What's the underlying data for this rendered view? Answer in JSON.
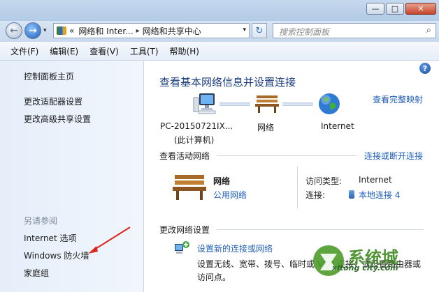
{
  "window": {
    "minimize_glyph": "—",
    "maximize_glyph": "□",
    "close_glyph": "✕"
  },
  "address": {
    "prefix": "«",
    "crumb1": "网络和 Inter...",
    "separator": "▸",
    "crumb2": "网络和共享中心",
    "dropdown_glyph": "▾"
  },
  "search": {
    "placeholder": "搜索控制面板"
  },
  "menu": [
    "文件(F)",
    "编辑(E)",
    "查看(V)",
    "工具(T)",
    "帮助(H)"
  ],
  "left_pane": {
    "home": "控制面板主页",
    "adapter": "更改适配器设置",
    "sharing": "更改高级共享设置",
    "see_also": "另请参阅",
    "internet_options": "Internet 选项",
    "firewall": "Windows 防火墙",
    "homegroup": "家庭组"
  },
  "main": {
    "help": "?",
    "title": "查看基本网络信息并设置连接",
    "full_map": "查看完整映射",
    "nodes": {
      "pc_name": "PC-20150721IX...",
      "pc_sub": "(此计算机)",
      "network": "网络",
      "internet": "Internet"
    },
    "active_section": "查看活动网络",
    "connect_link": "连接或断开连接",
    "active_network": {
      "name": "网络",
      "type": "公用网络",
      "access_type_label": "访问类型:",
      "access_type_value": "Internet",
      "connection_label": "连接:",
      "connection_value": "本地连接 4"
    },
    "change_section": "更改网络设置",
    "task": {
      "link": "设置新的连接或网络",
      "desc": "设置无线、宽带、拨号、临时或 VPN 连接；或设置路由器或访问点。"
    }
  },
  "watermark": {
    "site": "xitong city.com",
    "brand": "系统城"
  }
}
